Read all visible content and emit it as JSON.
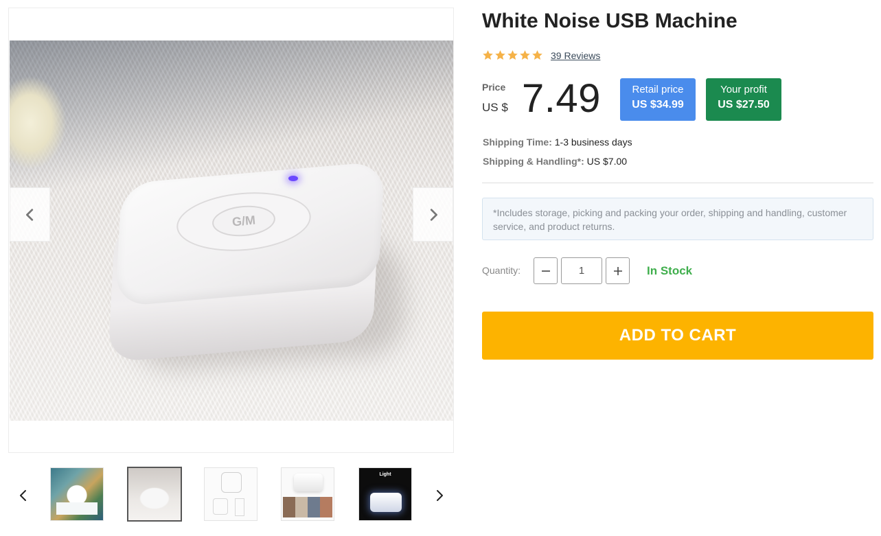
{
  "product": {
    "title": "White Noise USB Machine",
    "rating": 5,
    "reviews_label": "39 Reviews",
    "price_label": "Price",
    "currency_label": "US $",
    "price": "7.49",
    "retail": {
      "label": "Retail price",
      "value": "US $34.99",
      "color": "#4a8cec"
    },
    "profit": {
      "label": "Your profit",
      "value": "US $27.50",
      "color": "#1b8a4f"
    }
  },
  "shipping": {
    "time_label": "Shipping Time:",
    "time_value": "1-3 business days",
    "handling_label": "Shipping & Handling*:",
    "handling_value": "US $7.00",
    "note": "*Includes storage, picking and packing your order, shipping and handling, customer service, and product returns."
  },
  "device_label": "G/M",
  "quantity": {
    "label": "Quantity:",
    "value": "1",
    "minus_icon": "minus-icon",
    "plus_icon": "plus-icon"
  },
  "stock_status": "In Stock",
  "cart_button": {
    "label": "ADD TO CART",
    "color": "#fdb300"
  },
  "gallery": {
    "icons": [
      "chevron-left-icon",
      "chevron-right-icon"
    ],
    "thumbnails": 5,
    "active_thumbnail": 2,
    "thumb5_caption": "Light"
  },
  "colors": {
    "star": "#f5b248",
    "in_stock": "#3fae4c"
  }
}
